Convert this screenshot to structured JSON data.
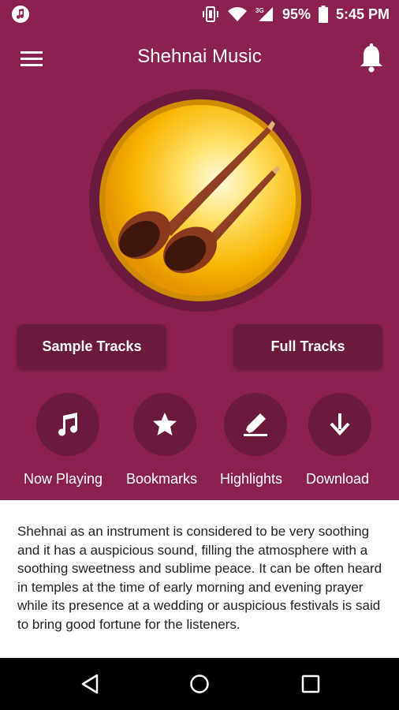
{
  "status_bar": {
    "app_icon": "music-note-circle-icon",
    "battery_percent": "95%",
    "time": "5:45 PM",
    "icons": [
      "vibrate-icon",
      "wifi-icon",
      "signal-3g-icon",
      "battery-icon"
    ]
  },
  "app_bar": {
    "title": "Shehnai Music",
    "menu_icon": "hamburger-menu-icon",
    "notification_icon": "bell-icon"
  },
  "hero": {
    "image": "shehnai-instrument-illustration"
  },
  "track_buttons": {
    "sample": "Sample Tracks",
    "full": "Full Tracks"
  },
  "actions": [
    {
      "label": "Now Playing",
      "icon": "music-note-icon"
    },
    {
      "label": "Bookmarks",
      "icon": "star-icon"
    },
    {
      "label": "Highlights",
      "icon": "highlighter-icon"
    },
    {
      "label": "Download",
      "icon": "download-arrow-icon"
    }
  ],
  "description": "Shehnai as an instrument is considered to be very soothing and it has a auspicious sound, filling the atmosphere with a soothing sweetness and sublime peace. It can be often heard in temples at the time of early morning and evening prayer while its presence at a wedding or auspicious festivals is said to bring good fortune for the listeners.",
  "nav_bar": {
    "icons": [
      "back-icon",
      "home-icon",
      "recents-icon"
    ]
  },
  "colors": {
    "primary": "#8a2150",
    "primary_dark": "#6a1a3c",
    "hero_gold": "#f2b400"
  }
}
